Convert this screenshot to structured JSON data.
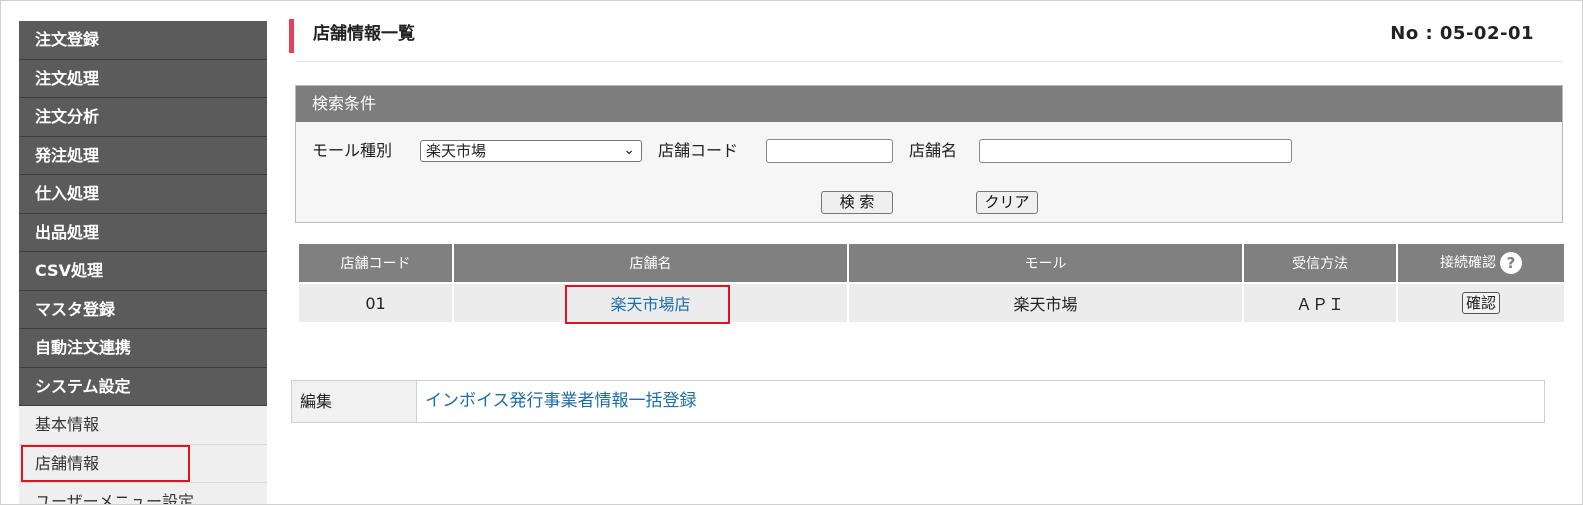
{
  "sidebar": {
    "main_items": [
      "注文登録",
      "注文処理",
      "注文分析",
      "発注処理",
      "仕入処理",
      "出品処理",
      "CSV処理",
      "マスタ登録",
      "自動注文連携",
      "システム設定"
    ],
    "sub_items": [
      "基本情報",
      "店舗情報",
      "ユーザーメニュー設定"
    ]
  },
  "header": {
    "title": "店舗情報一覧",
    "page_no": "No : 05-02-01"
  },
  "search": {
    "heading": "検索条件",
    "mall_label": "モール種別",
    "mall_selected": "楽天市場",
    "shop_code_label": "店舗コード",
    "shop_code_value": "",
    "shop_name_label": "店舗名",
    "shop_name_value": "",
    "search_button": "検 索",
    "clear_button": "クリア"
  },
  "results": {
    "columns": [
      "店舗コード",
      "店舗名",
      "モール",
      "受信方法",
      "接続確認"
    ],
    "help_glyph": "?",
    "rows": [
      {
        "code": "01",
        "name": "楽天市場店",
        "mall": "楽天市場",
        "method": "ＡＰＩ",
        "confirm": "確認"
      }
    ]
  },
  "edit": {
    "label": "編集",
    "link": "インボイス発行事業者情報一括登録"
  },
  "colors": {
    "accent": "#e4425a",
    "highlight": "#e0141e",
    "link": "#1d6ea6",
    "nav_bg": "#5b5b5b"
  }
}
